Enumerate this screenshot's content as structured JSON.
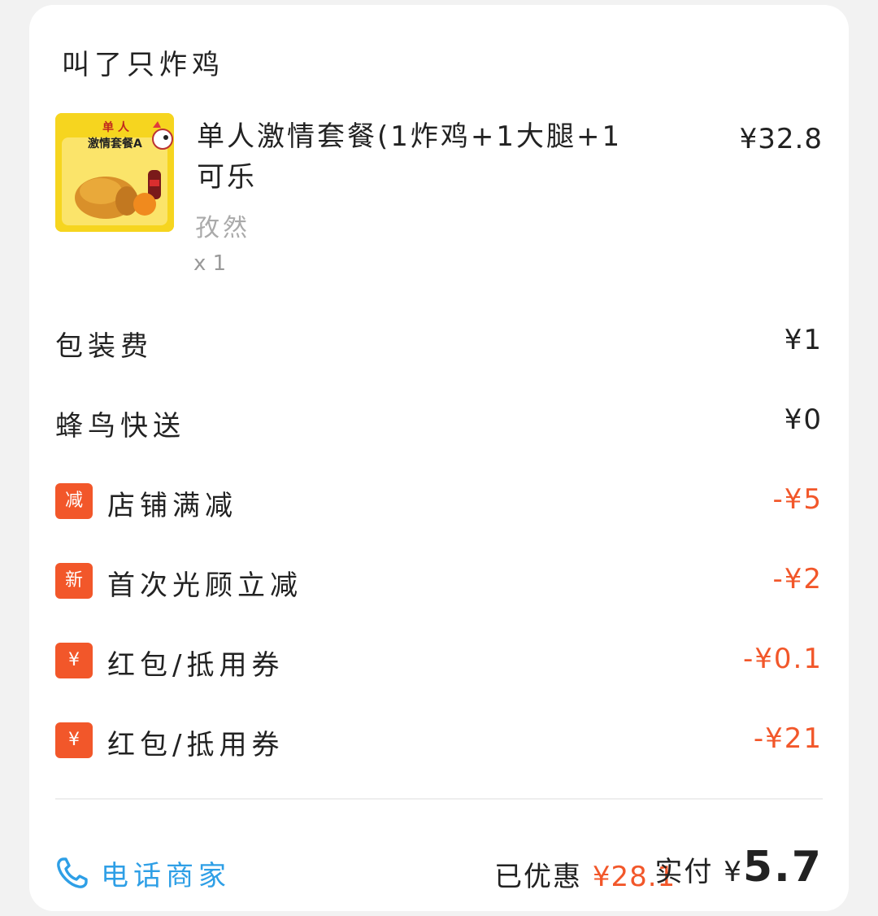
{
  "order": {
    "shop_name": "叫了只炸鸡",
    "item": {
      "name": "单人激情套餐(1炸鸡+1大腿+1可乐",
      "spec": "孜然",
      "quantity": "x 1",
      "price": "¥32.8",
      "thumb_text_line1": "单 人",
      "thumb_text_line2": "激情套餐A"
    },
    "fees": [
      {
        "label": "包装费",
        "amount": "¥1"
      },
      {
        "label": "蜂鸟快送",
        "amount": "¥0"
      }
    ],
    "discounts": [
      {
        "badge": "减",
        "label": "店铺满减",
        "amount": "-¥5"
      },
      {
        "badge": "新",
        "label": "首次光顾立减",
        "amount": "-¥2"
      },
      {
        "badge": "¥",
        "label": "红包/抵用券",
        "amount": "-¥0.1"
      },
      {
        "badge": "¥",
        "label": "红包/抵用券",
        "amount": "-¥21"
      }
    ],
    "footer": {
      "call_label": "电话商家",
      "saved_label": "已优惠",
      "saved_value": "¥28.1",
      "paid_label": "实付",
      "paid_currency": "¥",
      "paid_value": "5.7"
    }
  },
  "colors": {
    "discount": "#f2572a",
    "link": "#2e9fe6",
    "thumb_bg": "#f6d51f"
  },
  "icons": {
    "call": "phone-icon"
  }
}
